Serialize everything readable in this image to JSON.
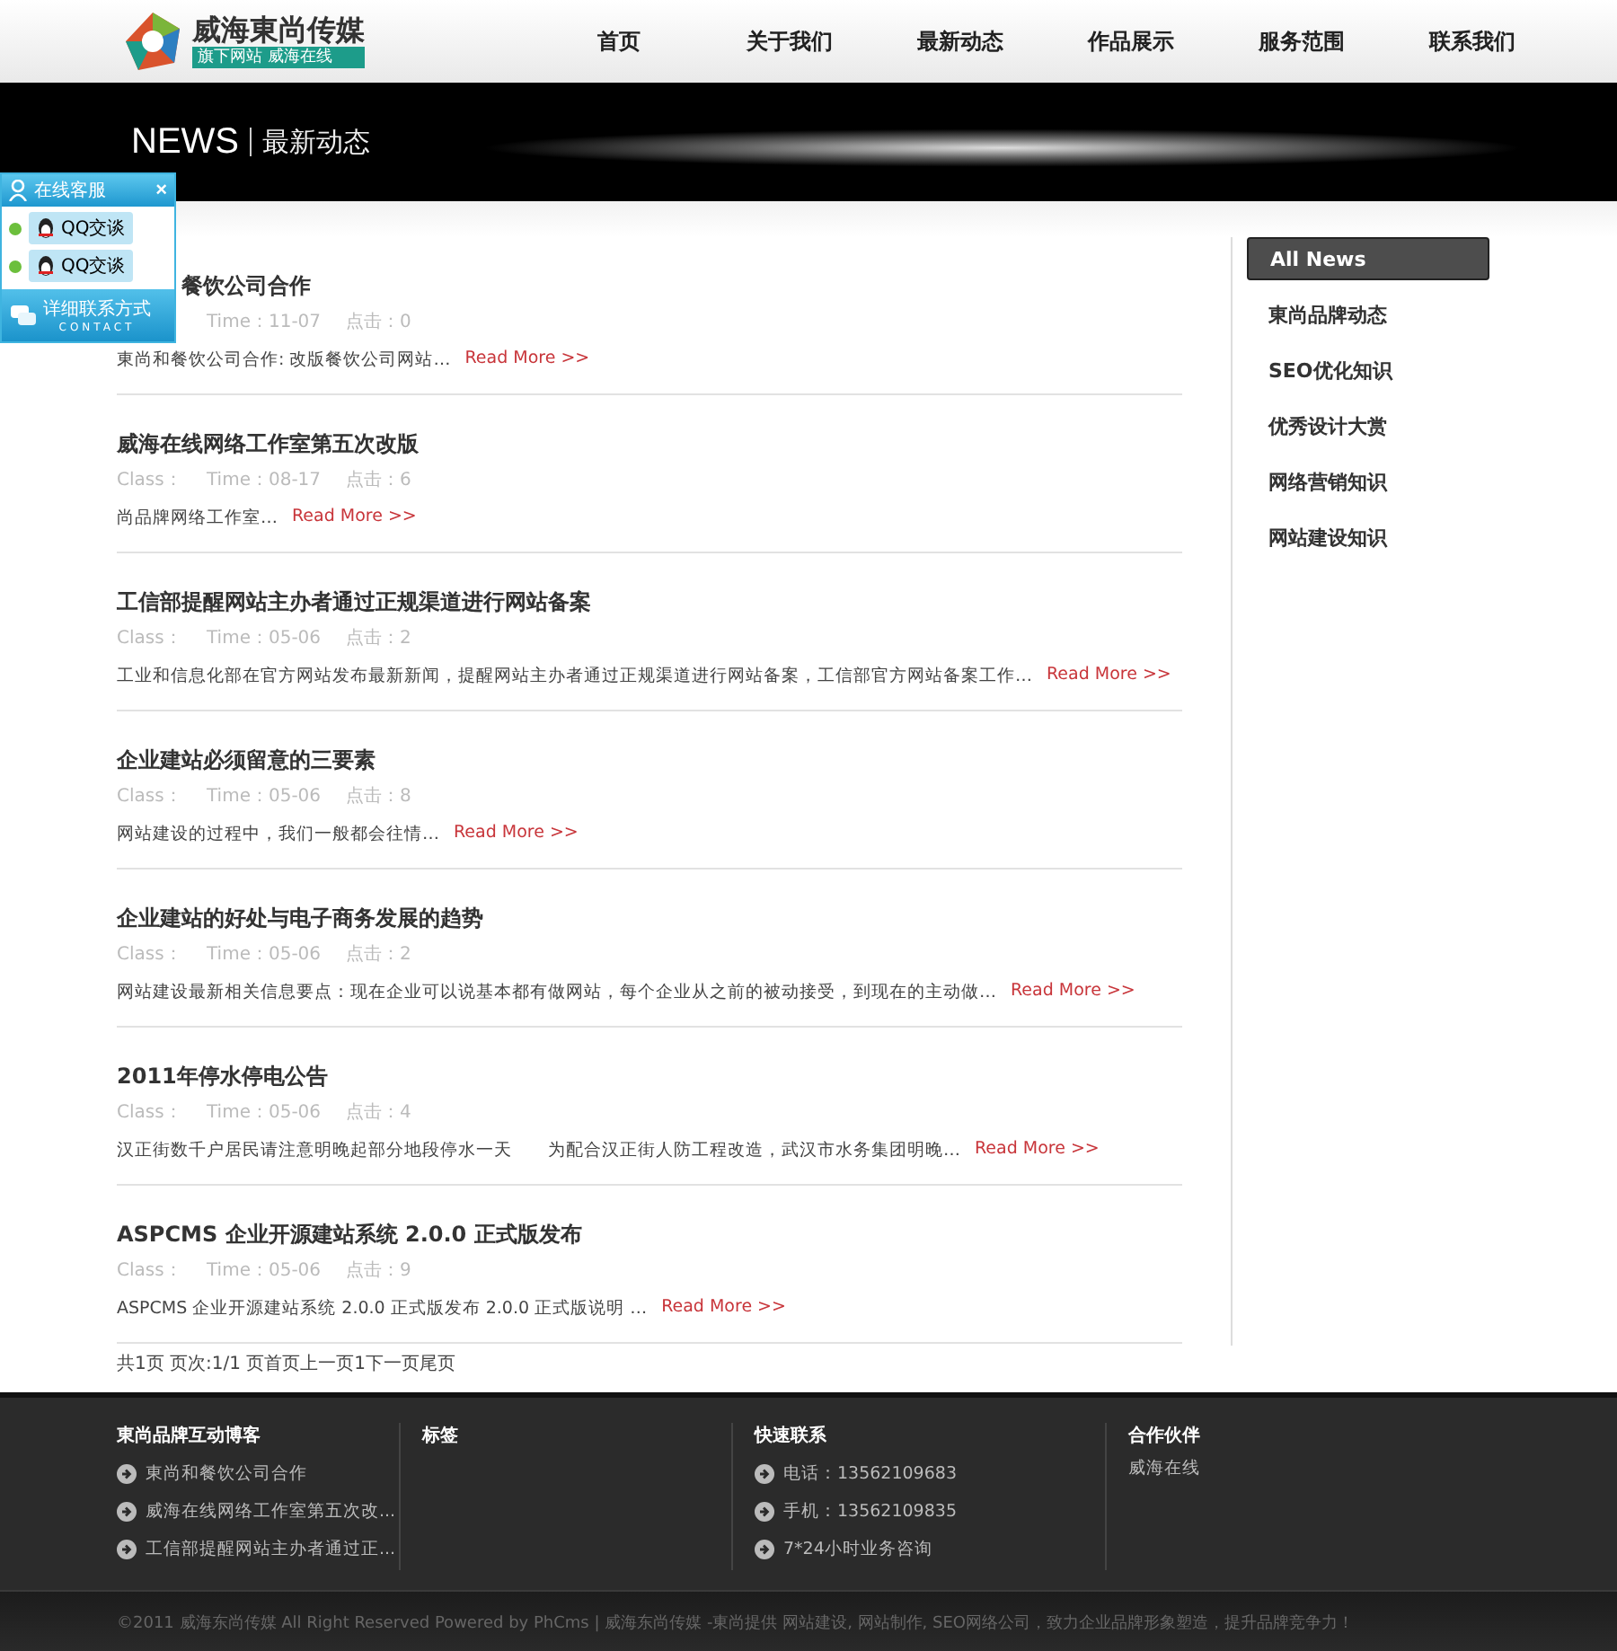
{
  "header": {
    "logo": {
      "name": "威海東尚传媒",
      "tagline": "旗下网站  威海在线"
    },
    "nav": [
      {
        "label": "首页"
      },
      {
        "label": "关于我们"
      },
      {
        "label": "最新动态"
      },
      {
        "label": "作品展示"
      },
      {
        "label": "服务范围"
      },
      {
        "label": "联系我们"
      }
    ]
  },
  "banner": {
    "title": "NEWS",
    "subtitle": "最新动态"
  },
  "chat_widget": {
    "title": "在线客服",
    "close": "×",
    "agents": [
      {
        "label": "QQ交谈",
        "online": true
      },
      {
        "label": "QQ交谈",
        "online": true
      }
    ],
    "contact": {
      "label": "详细联系方式",
      "sublabel": "CONTACT"
    }
  },
  "articles": [
    {
      "title": "餐饮公司合作",
      "time": "Time：11-07",
      "clicks": "点击：0",
      "summary": "東尚和餐饮公司合作: 改版餐饮公司网站…",
      "read_more": "Read More >>"
    },
    {
      "title": "威海在线网络工作室第五次改版",
      "class": "Class：",
      "time": "Time：08-17",
      "clicks": "点击：6",
      "summary": "尚品牌网络工作室…",
      "read_more": "Read More >>"
    },
    {
      "title": "工信部提醒网站主办者通过正规渠道进行网站备案",
      "class": "Class：",
      "time": "Time：05-06",
      "clicks": "点击：2",
      "summary": "工业和信息化部在官方网站发布最新新闻，提醒网站主办者通过正规渠道进行网站备案，工信部官方网站备案工作…",
      "read_more": "Read More >>"
    },
    {
      "title": "企业建站必须留意的三要素",
      "class": "Class：",
      "time": "Time：05-06",
      "clicks": "点击：8",
      "summary": "网站建设的过程中，我们一般都会往情…",
      "read_more": "Read More >>"
    },
    {
      "title": "企业建站的好处与电子商务发展的趋势",
      "class": "Class：",
      "time": "Time：05-06",
      "clicks": "点击：2",
      "summary": "网站建设最新相关信息要点：现在企业可以说基本都有做网站，每个企业从之前的被动接受，到现在的主动做…",
      "read_more": "Read More >>"
    },
    {
      "title": "2011年停水停电公告",
      "class": "Class：",
      "time": "Time：05-06",
      "clicks": "点击：4",
      "summary": "汉正街数千户居民请注意明晚起部分地段停水一天　　为配合汉正街人防工程改造，武汉市水务集团明晚…",
      "read_more": "Read More >>"
    },
    {
      "title": "ASPCMS 企业开源建站系统  2.0.0 正式版发布",
      "class": "Class：",
      "time": "Time：05-06",
      "clicks": "点击：9",
      "summary": "ASPCMS 企业开源建站系统  2.0.0 正式版发布   2.0.0 正式版说明 …",
      "read_more": "Read More >>"
    }
  ],
  "pagination": "共1页 页次:1/1 页首页上一页1下一页尾页",
  "sidebar": {
    "items": [
      {
        "label": "All News",
        "selected": true
      },
      {
        "label": "東尚品牌动态",
        "selected": false
      },
      {
        "label": "SEO优化知识",
        "selected": false
      },
      {
        "label": "优秀设计大赏",
        "selected": false
      },
      {
        "label": "网络营销知识",
        "selected": false
      },
      {
        "label": "网站建设知识",
        "selected": false
      }
    ]
  },
  "footer": {
    "columns": [
      {
        "title": "東尚品牌互动博客",
        "items": [
          "東尚和餐饮公司合作",
          "威海在线网络工作室第五次改...",
          "工信部提醒网站主办者通过正..."
        ]
      },
      {
        "title": "标签"
      },
      {
        "title": "快速联系",
        "items": [
          "电话：13562109683",
          "手机：13562109835",
          "7*24小时业务咨询"
        ]
      },
      {
        "title": "合作伙伴",
        "text": "威海在线"
      }
    ],
    "copyright": "©2011 威海东尚传媒  All Right Reserved Powered by PhCms | 威海东尚传媒  -東尚提供  网站建设, 网站制作, SEO网络公司，致力企业品牌形象塑造，提升品牌竞争力！"
  }
}
